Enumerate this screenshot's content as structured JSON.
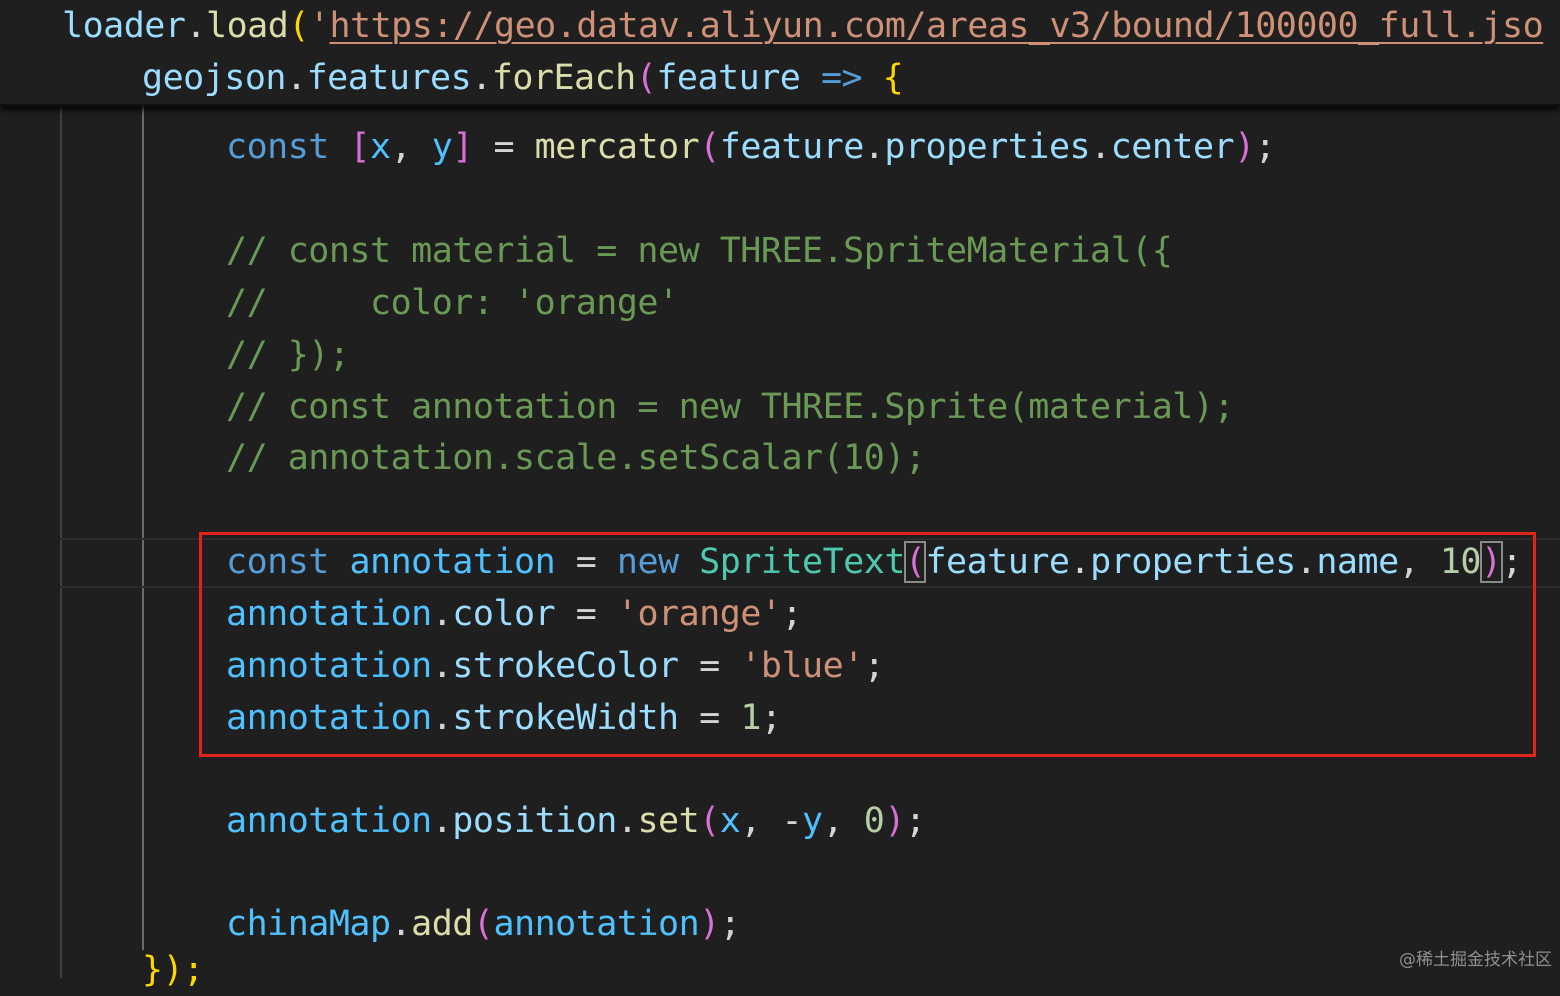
{
  "theme": {
    "background": "#1f1f1f",
    "keyword": "#569cd6",
    "variable": "#9cdcfe",
    "constant": "#4fc1ff",
    "function": "#dcdcaa",
    "class": "#4ec9b0",
    "string": "#ce9178",
    "number": "#b5cea8",
    "comment": "#6a9955",
    "bracket_level_1": "#ffd700",
    "bracket_level_2": "#da70d6",
    "bracket_level_3": "#179fff",
    "annotation_box": "#e0241c"
  },
  "sticky_scroll": {
    "line1": {
      "obj": "loader",
      "method": "load",
      "quote": "'",
      "url": "https://geo.datav.aliyun.com/areas_v3/bound/100000_full.jso"
    },
    "line2": {
      "obj": "geojson",
      "prop": "features",
      "method": "forEach",
      "param": "feature",
      "arrow": "=>"
    }
  },
  "code": {
    "l1": {
      "kw": "const",
      "x": "x",
      "y": "y",
      "fn": "mercator",
      "obj": "feature",
      "p1": "properties",
      "p2": "center"
    },
    "c1": "// const material = new THREE.SpriteMaterial({",
    "c2": "//     color: 'orange'",
    "c3": "// });",
    "c4": "// const annotation = new THREE.Sprite(material);",
    "c5": "// annotation.scale.setScalar(10);",
    "l7": {
      "kw": "const",
      "var": "annotation",
      "new": "new",
      "cls": "SpriteText",
      "obj": "feature",
      "p1": "properties",
      "p2": "name",
      "num": "10"
    },
    "l8": {
      "obj": "annotation",
      "prop": "color",
      "str": "'orange'"
    },
    "l9": {
      "obj": "annotation",
      "prop": "strokeColor",
      "str": "'blue'"
    },
    "l10": {
      "obj": "annotation",
      "prop": "strokeWidth",
      "num": "1"
    },
    "l11": {
      "obj": "annotation",
      "p1": "position",
      "fn": "set",
      "x": "x",
      "y": "y",
      "num": "0"
    },
    "l12": {
      "obj": "chinaMap",
      "fn": "add",
      "arg": "annotation"
    },
    "l13": {
      "close": "});"
    }
  },
  "watermark": "@稀土掘金技术社区"
}
